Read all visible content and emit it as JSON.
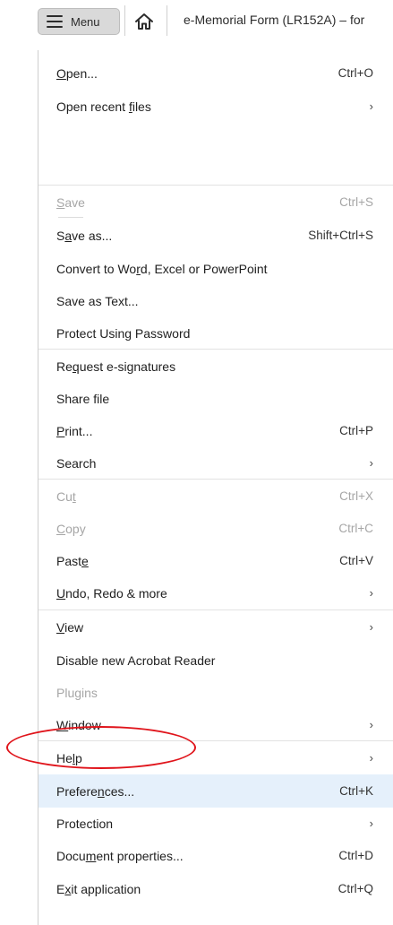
{
  "toolbar": {
    "menu_label": "Menu",
    "doc_title": "e-Memorial Form (LR152A) – for"
  },
  "menu": {
    "items": [
      {
        "id": "open",
        "pre": "",
        "ul": "O",
        "post": "pen...",
        "shortcut": "Ctrl+O",
        "submenu": false,
        "disabled": false
      },
      {
        "id": "open-recent",
        "pre": "Open recent ",
        "ul": "f",
        "post": "iles",
        "shortcut": "",
        "submenu": true,
        "disabled": false
      },
      {
        "id": "save",
        "pre": "",
        "ul": "S",
        "post": "ave",
        "shortcut": "Ctrl+S",
        "submenu": false,
        "disabled": true
      },
      {
        "id": "save-as",
        "pre": "S",
        "ul": "a",
        "post": "ve as...",
        "shortcut": "Shift+Ctrl+S",
        "submenu": false,
        "disabled": false
      },
      {
        "id": "convert",
        "pre": "Convert to Wo",
        "ul": "r",
        "post": "d, Excel or PowerPoint",
        "shortcut": "",
        "submenu": false,
        "disabled": false
      },
      {
        "id": "save-text",
        "pre": "Save as Text...",
        "ul": "",
        "post": "",
        "shortcut": "",
        "submenu": false,
        "disabled": false
      },
      {
        "id": "protect-password",
        "pre": "Protect Using Password",
        "ul": "",
        "post": "",
        "shortcut": "",
        "submenu": false,
        "disabled": false
      },
      {
        "id": "request-esign",
        "pre": "Re",
        "ul": "q",
        "post": "uest e-signatures",
        "shortcut": "",
        "submenu": false,
        "disabled": false
      },
      {
        "id": "share-file",
        "pre": "Share file",
        "ul": "",
        "post": "",
        "shortcut": "",
        "submenu": false,
        "disabled": false
      },
      {
        "id": "print",
        "pre": "",
        "ul": "P",
        "post": "rint...",
        "shortcut": "Ctrl+P",
        "submenu": false,
        "disabled": false
      },
      {
        "id": "search",
        "pre": "Search",
        "ul": "",
        "post": "",
        "shortcut": "",
        "submenu": true,
        "disabled": false
      },
      {
        "id": "cut",
        "pre": "Cu",
        "ul": "t",
        "post": "",
        "shortcut": "Ctrl+X",
        "submenu": false,
        "disabled": true
      },
      {
        "id": "copy",
        "pre": "",
        "ul": "C",
        "post": "opy",
        "shortcut": "Ctrl+C",
        "submenu": false,
        "disabled": true
      },
      {
        "id": "paste",
        "pre": "Past",
        "ul": "e",
        "post": "",
        "shortcut": "Ctrl+V",
        "submenu": false,
        "disabled": false
      },
      {
        "id": "undo-redo",
        "pre": "",
        "ul": "U",
        "post": "ndo, Redo & more",
        "shortcut": "",
        "submenu": true,
        "disabled": false
      },
      {
        "id": "view",
        "pre": "",
        "ul": "V",
        "post": "iew",
        "shortcut": "",
        "submenu": true,
        "disabled": false
      },
      {
        "id": "disable-new",
        "pre": "Disable new Acrobat Reader",
        "ul": "",
        "post": "",
        "shortcut": "",
        "submenu": false,
        "disabled": false
      },
      {
        "id": "plugins",
        "pre": "Plugins",
        "ul": "",
        "post": "",
        "shortcut": "",
        "submenu": false,
        "disabled": true
      },
      {
        "id": "window",
        "pre": "",
        "ul": "W",
        "post": "indow",
        "shortcut": "",
        "submenu": true,
        "disabled": false
      },
      {
        "id": "help",
        "pre": "He",
        "ul": "l",
        "post": "p",
        "shortcut": "",
        "submenu": true,
        "disabled": false
      },
      {
        "id": "preferences",
        "pre": "Prefere",
        "ul": "n",
        "post": "ces...",
        "shortcut": "Ctrl+K",
        "submenu": false,
        "disabled": false,
        "highlight": true
      },
      {
        "id": "protection",
        "pre": "Protection",
        "ul": "",
        "post": "",
        "shortcut": "",
        "submenu": true,
        "disabled": false
      },
      {
        "id": "doc-properties",
        "pre": "Docu",
        "ul": "m",
        "post": "ent properties...",
        "shortcut": "Ctrl+D",
        "submenu": false,
        "disabled": false
      },
      {
        "id": "exit",
        "pre": "E",
        "ul": "x",
        "post": "it application",
        "shortcut": "Ctrl+Q",
        "submenu": false,
        "disabled": false
      }
    ],
    "submenu_chevron": "›"
  },
  "colors": {
    "highlight": "#e5f0fb",
    "disabled_text": "#a6a6a6",
    "annotation": "#e0141b"
  },
  "icons": {
    "menu": "hamburger-icon",
    "home": "home-icon",
    "submenu": "chevron-right-icon"
  }
}
